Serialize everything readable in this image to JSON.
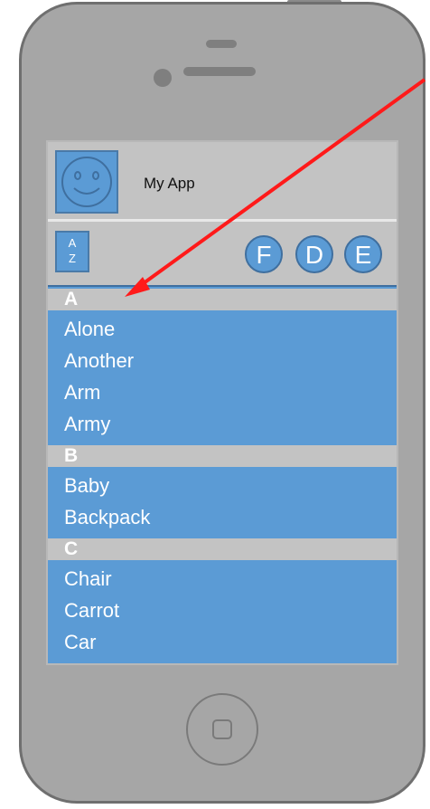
{
  "app": {
    "title": "My App"
  },
  "toolbar": {
    "sort_top": "A",
    "sort_bottom": "Z",
    "buttons": [
      "F",
      "D",
      "E"
    ]
  },
  "list": {
    "sections": [
      {
        "header": "A",
        "items": [
          "Alone",
          "Another",
          "Arm",
          "Army"
        ]
      },
      {
        "header": "B",
        "items": [
          "Baby",
          "Backpack"
        ]
      },
      {
        "header": "C",
        "items": [
          "Chair",
          "Carrot",
          "Car"
        ]
      }
    ]
  },
  "colors": {
    "accent": "#5b9bd5",
    "phone_body": "#a6a6a6",
    "annotation": "#ff1a1a"
  },
  "icons": {
    "avatar": "smiley-face-icon",
    "home": "home-button-icon"
  }
}
